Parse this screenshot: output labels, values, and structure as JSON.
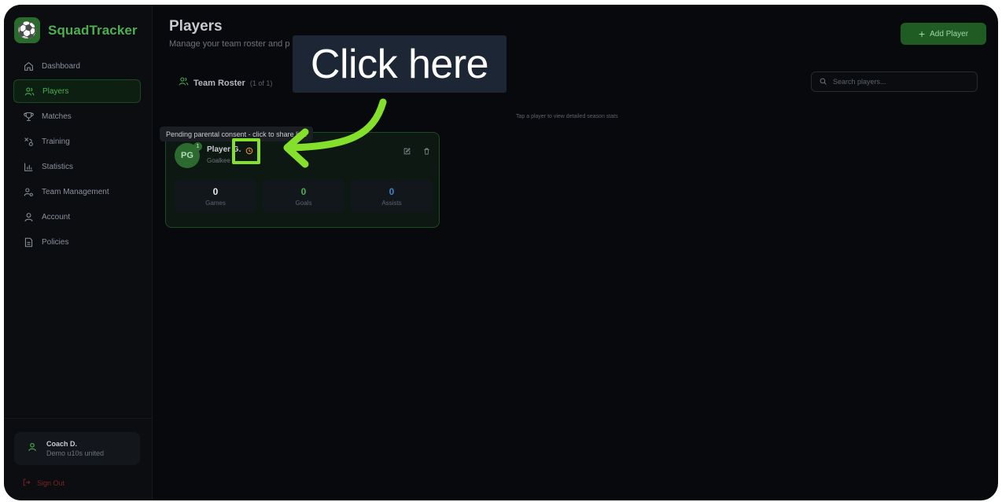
{
  "app": {
    "name": "SquadTracker",
    "logo_glyph": "⚽"
  },
  "sidebar": {
    "items": [
      {
        "label": "Dashboard",
        "icon": "home-icon",
        "active": false
      },
      {
        "label": "Players",
        "icon": "users-icon",
        "active": true
      },
      {
        "label": "Matches",
        "icon": "trophy-icon",
        "active": false
      },
      {
        "label": "Training",
        "icon": "training-icon",
        "active": false
      },
      {
        "label": "Statistics",
        "icon": "bar-chart-icon",
        "active": false
      },
      {
        "label": "Team Management",
        "icon": "team-settings-icon",
        "active": false
      },
      {
        "label": "Account",
        "icon": "user-icon",
        "active": false
      },
      {
        "label": "Policies",
        "icon": "document-icon",
        "active": false
      }
    ],
    "user": {
      "name": "Coach D.",
      "team": "Demo u10s united"
    },
    "signout_label": "Sign Out"
  },
  "header": {
    "title": "Players",
    "subtitle": "Manage your team roster and p",
    "add_button_label": "Add Player"
  },
  "roster": {
    "title": "Team Roster",
    "count": "(1 of 1)",
    "hint": "Tap a player to view detailed season stats"
  },
  "search": {
    "placeholder": "Search players..."
  },
  "player": {
    "initials": "PG",
    "badge": "1",
    "name": "Player G.",
    "position": "Goalkee",
    "tooltip": "Pending parental consent - click to share link",
    "stats": [
      {
        "value": "0",
        "label": "Games",
        "color": "#e6e8eb"
      },
      {
        "value": "0",
        "label": "Goals",
        "color": "#4caf50"
      },
      {
        "value": "0",
        "label": "Assists",
        "color": "#3b82c4"
      }
    ]
  },
  "overlay": {
    "callout_text": "Click here",
    "accent": "#84e02a"
  },
  "colors": {
    "brand": "#4fae52",
    "background": "#07090c",
    "danger": "#7a2424"
  }
}
